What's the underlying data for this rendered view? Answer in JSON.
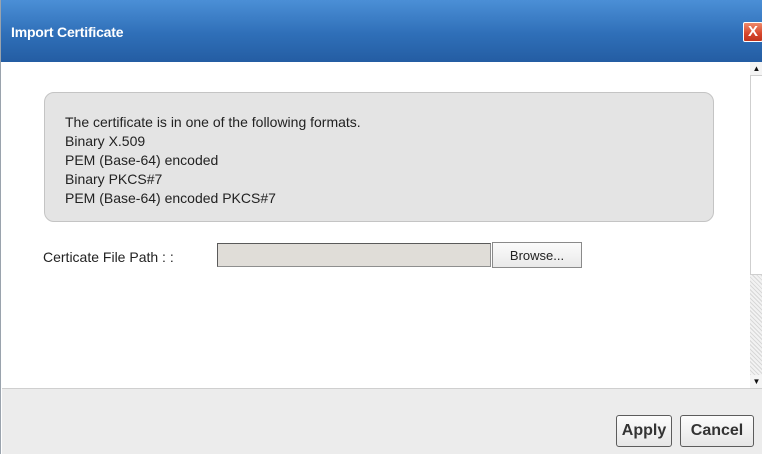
{
  "dialog": {
    "title": "Import Certificate",
    "close_icon": "close-icon",
    "close_glyph": "X"
  },
  "info": {
    "lines": [
      "The certificate is in one of the following formats.",
      "Binary X.509",
      "PEM (Base-64) encoded",
      "Binary PKCS#7",
      "PEM (Base-64) encoded PKCS#7"
    ]
  },
  "form": {
    "file_path_label": "Certicate File Path : :",
    "file_path_value": "",
    "browse_label": "Browse..."
  },
  "scrollbar": {
    "up_glyph": "▲",
    "down_glyph": "▼"
  },
  "footer": {
    "apply_label": "Apply",
    "cancel_label": "Cancel"
  },
  "colors": {
    "titlebar": "#2f6fb8",
    "close_button": "#d6452b",
    "info_box": "#e4e4e4",
    "file_input": "#e0ddd8"
  }
}
